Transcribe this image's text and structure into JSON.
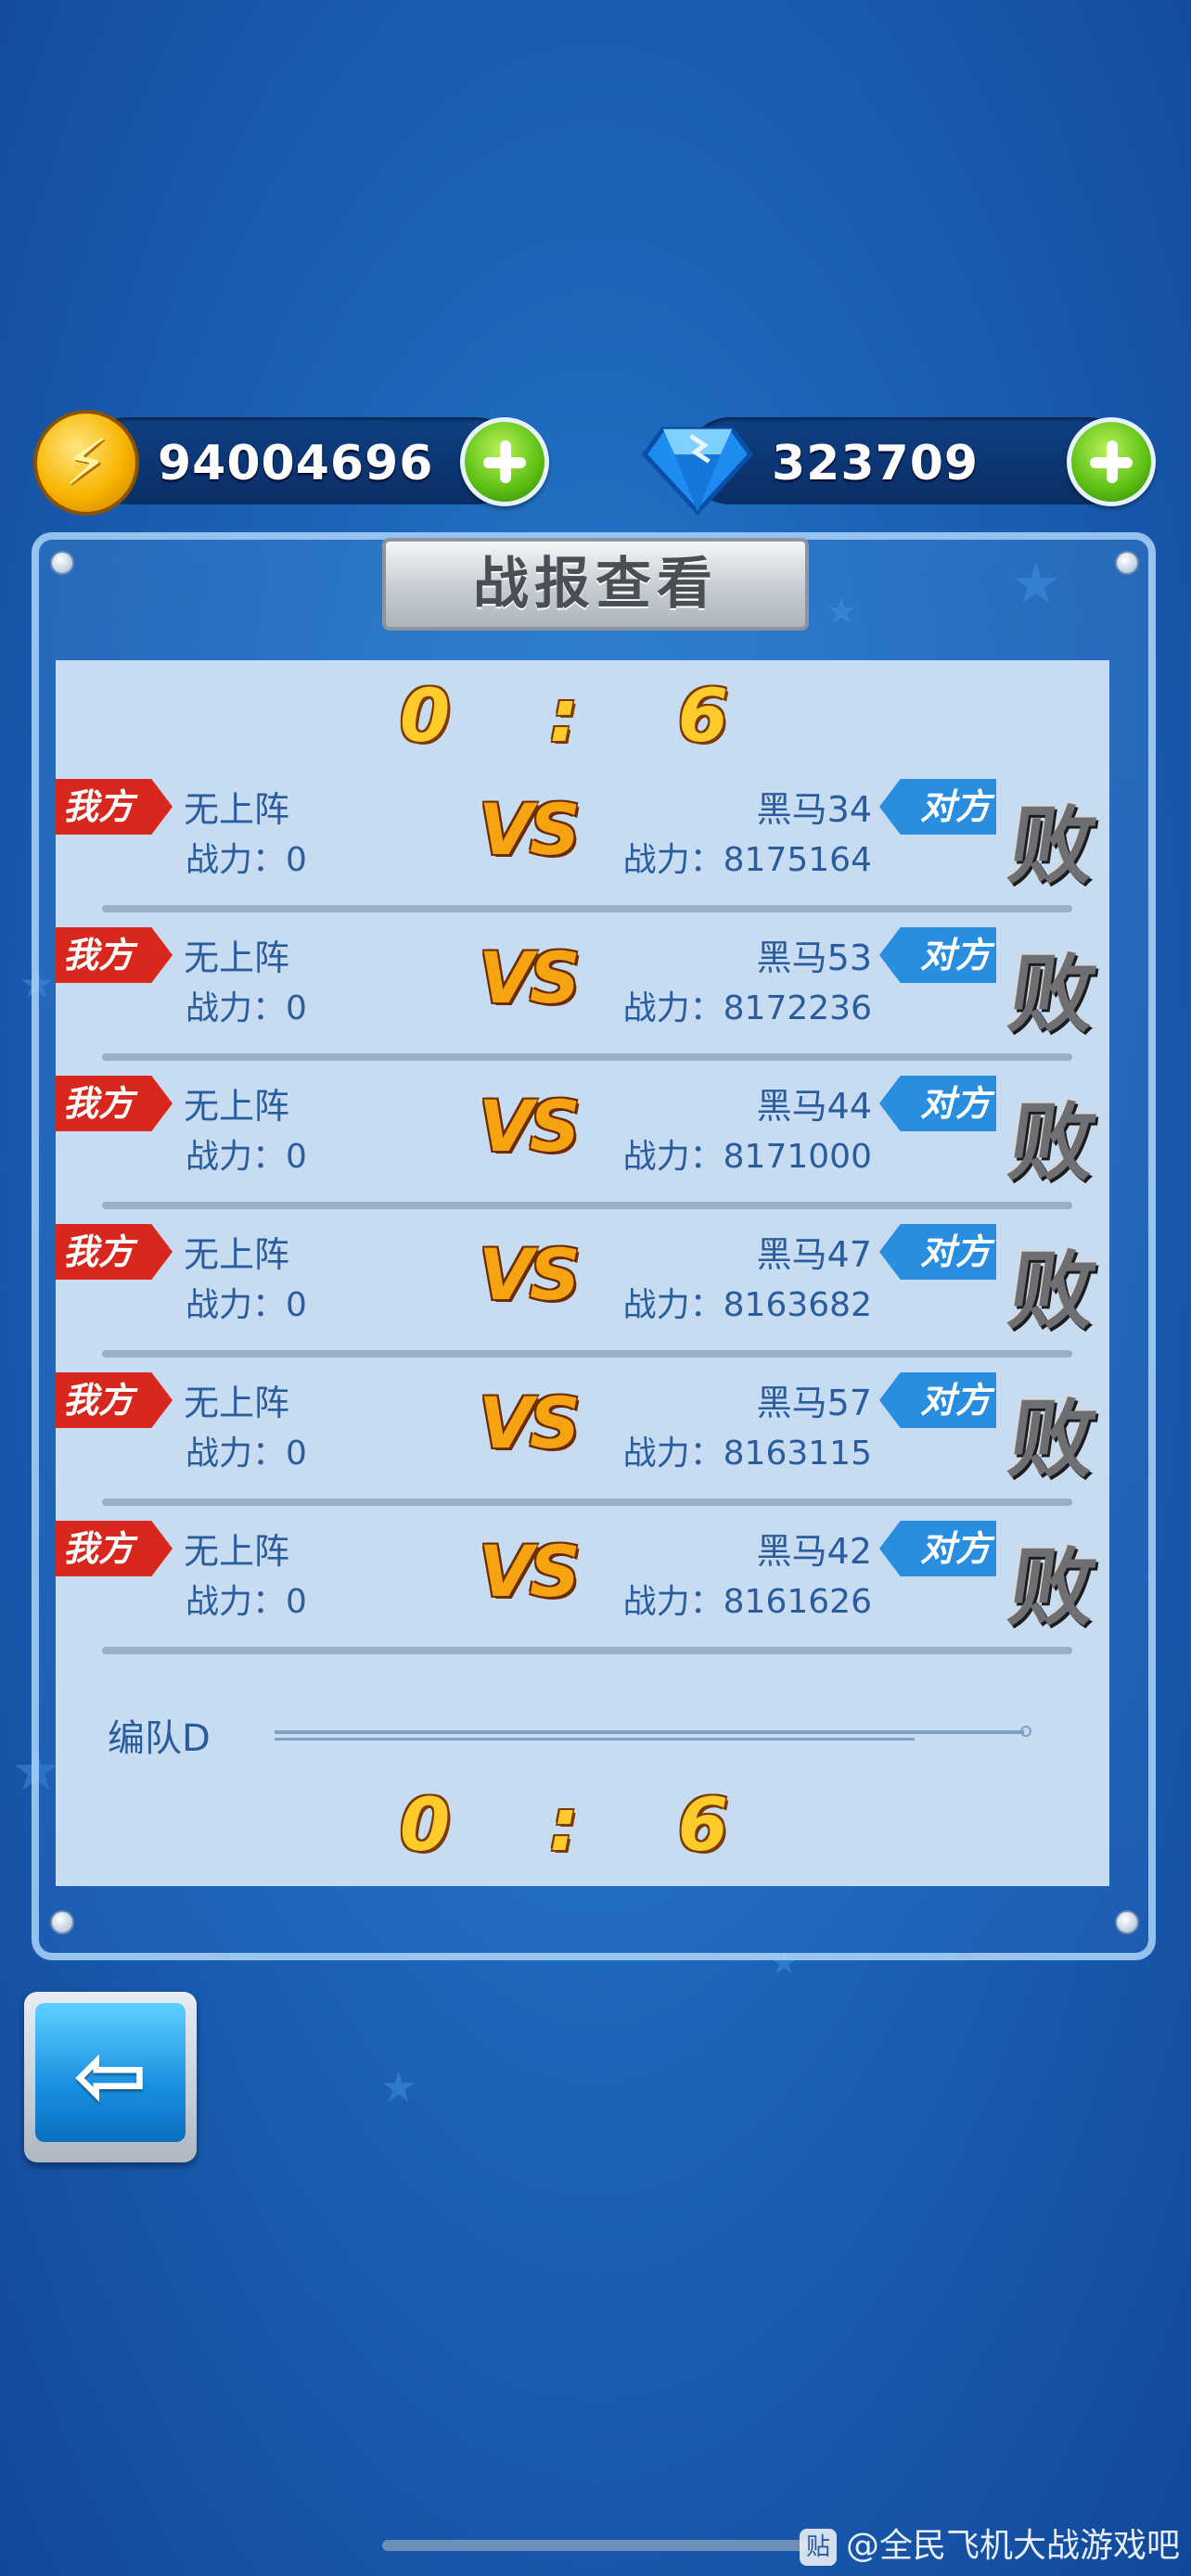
{
  "currency": {
    "gold": "94004696",
    "diamonds": "323709",
    "gold_icon_glyph": "⚡"
  },
  "panel": {
    "title": "战报查看",
    "score_top": "0 : 6",
    "score_bottom": "0 : 6",
    "team_label": "编队D"
  },
  "battles": [
    {
      "my_tag": "我方",
      "my_name": "无上阵",
      "my_power": "战力：0",
      "vs": "VS",
      "op_name": "黑马34",
      "op_power": "战力：8175164",
      "op_tag": "对方",
      "result": "败"
    },
    {
      "my_tag": "我方",
      "my_name": "无上阵",
      "my_power": "战力：0",
      "vs": "VS",
      "op_name": "黑马53",
      "op_power": "战力：8172236",
      "op_tag": "对方",
      "result": "败"
    },
    {
      "my_tag": "我方",
      "my_name": "无上阵",
      "my_power": "战力：0",
      "vs": "VS",
      "op_name": "黑马44",
      "op_power": "战力：8171000",
      "op_tag": "对方",
      "result": "败"
    },
    {
      "my_tag": "我方",
      "my_name": "无上阵",
      "my_power": "战力：0",
      "vs": "VS",
      "op_name": "黑马47",
      "op_power": "战力：8163682",
      "op_tag": "对方",
      "result": "败"
    },
    {
      "my_tag": "我方",
      "my_name": "无上阵",
      "my_power": "战力：0",
      "vs": "VS",
      "op_name": "黑马57",
      "op_power": "战力：8163115",
      "op_tag": "对方",
      "result": "败"
    },
    {
      "my_tag": "我方",
      "my_name": "无上阵",
      "my_power": "战力：0",
      "vs": "VS",
      "op_name": "黑马42",
      "op_power": "战力：8161626",
      "op_tag": "对方",
      "result": "败"
    }
  ],
  "back_button": {
    "glyph": "⇦"
  },
  "watermark": {
    "icon": "贴",
    "text": "@全民飞机大战游戏吧"
  },
  "icons": [
    "gold-coin-icon",
    "diamond-icon",
    "plus-icon",
    "back-arrow-icon",
    "star-icon"
  ],
  "colors": {
    "background": "#1c64b9",
    "list_bg": "#c8dcf1",
    "my_tag": "#d8281e",
    "op_tag": "#2a8ee0",
    "score": "#ffcb2a",
    "text": "#2a5d9e"
  }
}
